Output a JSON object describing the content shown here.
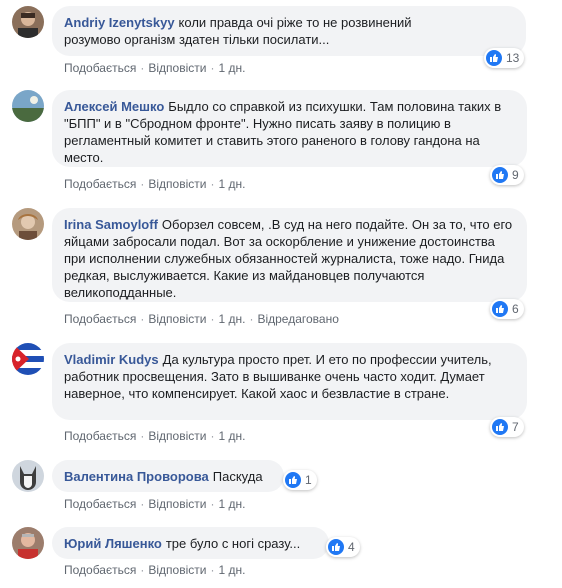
{
  "comments": [
    {
      "author": "Andriy Izenytskyy",
      "text": "коли правда очі ріже то не розвинений розумово організм здатен тільки посилати...",
      "reaction_count": "13",
      "actions": {
        "like": "Подобається",
        "reply": "Відповісти",
        "time": "1 дн.",
        "edited": ""
      }
    },
    {
      "author": "Алексей Мешко",
      "text": "Быдло со справкой из психушки. Там половина таких в \"БПП\" и в \"Сбродном фронте\". Нужно писать заяву в полицию в регламентный комитет и ставить этого раненого в голову гандона на место.",
      "reaction_count": "9",
      "actions": {
        "like": "Подобається",
        "reply": "Відповісти",
        "time": "1 дн.",
        "edited": ""
      }
    },
    {
      "author": "Irina Samoyloff",
      "text": "Оборзел совсем, .В суд на него подайте. Он за то, что его яйцами забросали подал. Вот за оскорбление и унижение достоинства при исполнении служебных обязанностей журналиста, тоже надо. Гнида редкая, выслуживается. Какие из майдановцев получаются великоподданные.",
      "reaction_count": "6",
      "actions": {
        "like": "Подобається",
        "reply": "Відповісти",
        "time": "1 дн.",
        "edited": "Відредаговано"
      }
    },
    {
      "author": "Vladimir Kudys",
      "text": "Да культура просто прет. И ето по профессии учитель, работник просвещения. Зато в вышиванке очень часто ходит. Думает наверное, что компенсирует. Какой хаос и безвластие в стране.",
      "reaction_count": "7",
      "actions": {
        "like": "Подобається",
        "reply": "Відповісти",
        "time": "1 дн.",
        "edited": ""
      }
    },
    {
      "author": "Валентина Проворова",
      "text": "Паскуда",
      "reaction_count": "1",
      "actions": {
        "like": "Подобається",
        "reply": "Відповісти",
        "time": "1 дн.",
        "edited": ""
      }
    },
    {
      "author": "Юрий Ляшенко",
      "text": "тре було с ногі сразу...",
      "reaction_count": "4",
      "actions": {
        "like": "Подобається",
        "reply": "Відповісти",
        "time": "1 дн.",
        "edited": ""
      }
    }
  ],
  "colors": {
    "author": "#385898",
    "bubble": "#f2f3f5",
    "like": "#2078f4",
    "meta": "#606770"
  },
  "icons": {
    "reaction": "like-thumb-icon"
  }
}
